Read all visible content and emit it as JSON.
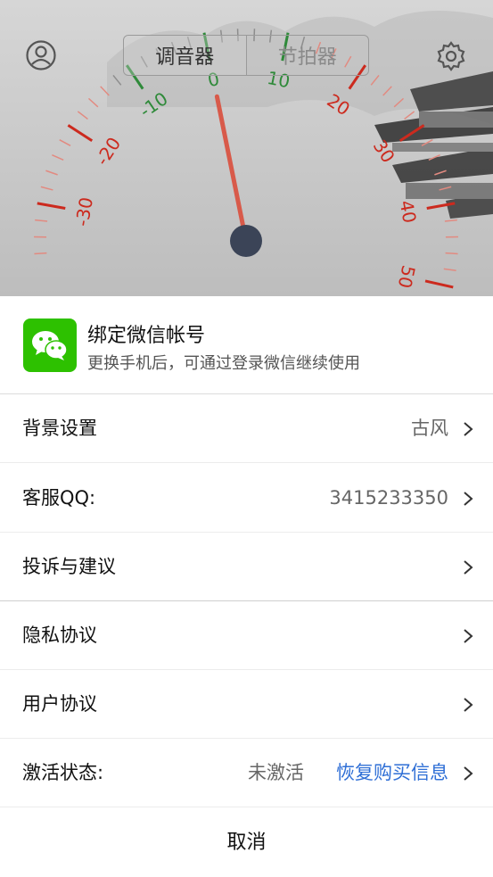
{
  "tuner": {
    "tabs": [
      "调音器",
      "节拍器"
    ],
    "active_tab": "调音器",
    "dial_labels": [
      "-30",
      "-20",
      "-10",
      "0",
      "10",
      "20",
      "30",
      "40",
      "50"
    ],
    "needle_value": 0,
    "colors": {
      "red": "#cc2a1e",
      "green": "#2f8a3a",
      "needle": "#d85a4a",
      "pivot": "#3b4457"
    }
  },
  "sheet": {
    "wechat": {
      "title": "绑定微信帐号",
      "subtitle": "更换手机后，可通过登录微信继续使用"
    },
    "rows": [
      {
        "label": "背景设置",
        "value": "古风"
      },
      {
        "label": "客服QQ:",
        "value": "3415233350"
      },
      {
        "label": "投诉与建议",
        "value": ""
      },
      {
        "label": "隐私协议",
        "value": ""
      },
      {
        "label": "用户协议",
        "value": ""
      },
      {
        "label": "激活状态:",
        "status": "未激活",
        "link": "恢复购买信息"
      }
    ],
    "cancel": "取消"
  }
}
